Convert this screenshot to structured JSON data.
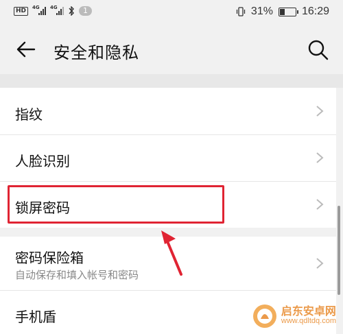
{
  "status_bar": {
    "hd_label": "HD",
    "network_label_1": "4G",
    "network_label_2": "4G",
    "notification_count": "1",
    "battery": "31%",
    "time": "16:29"
  },
  "header": {
    "title": "安全和隐私"
  },
  "settings": {
    "items": [
      {
        "label": "指纹"
      },
      {
        "label": "人脸识别"
      },
      {
        "label": "锁屏密码"
      },
      {
        "label": "密码保险箱",
        "subtitle": "自动保存和填入帐号和密码"
      },
      {
        "label": "手机盾"
      }
    ]
  },
  "watermark": {
    "name": "启东安卓网",
    "url": "www.qdltdq.com"
  },
  "colors": {
    "highlight": "#e02433",
    "watermark": "#e8892b"
  }
}
